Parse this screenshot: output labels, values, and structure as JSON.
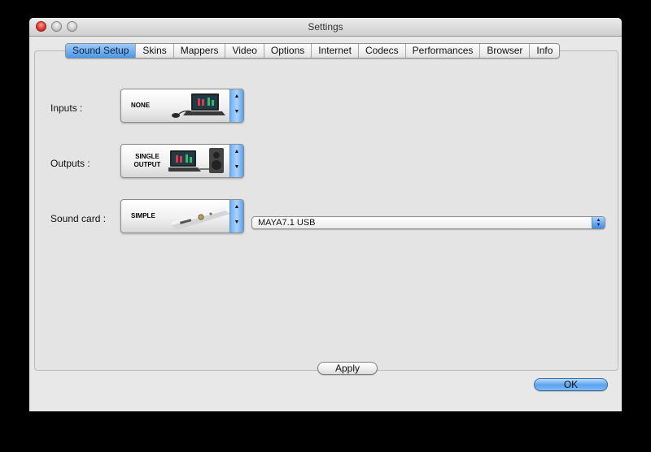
{
  "window": {
    "title": "Settings"
  },
  "tabs": [
    {
      "label": "Sound Setup",
      "active": true
    },
    {
      "label": "Skins"
    },
    {
      "label": "Mappers"
    },
    {
      "label": "Video"
    },
    {
      "label": "Options"
    },
    {
      "label": "Internet"
    },
    {
      "label": "Codecs"
    },
    {
      "label": "Performances"
    },
    {
      "label": "Browser"
    },
    {
      "label": "Info"
    }
  ],
  "sound_setup": {
    "inputs": {
      "label": "Inputs :",
      "value": "NONE",
      "icon": "laptop-with-mouse-icon"
    },
    "outputs": {
      "label": "Outputs :",
      "value": "SINGLE OUTPUT",
      "icon": "laptop-with-speaker-icon"
    },
    "sound_card": {
      "label": "Sound card :",
      "value": "SIMPLE",
      "icon": "laptop-audio-jack-icon",
      "device": "MAYA7.1 USB"
    }
  },
  "buttons": {
    "apply": "Apply",
    "ok": "OK"
  },
  "colors": {
    "accent": "#4b97e8",
    "window_bg": "#e8e8e8"
  }
}
